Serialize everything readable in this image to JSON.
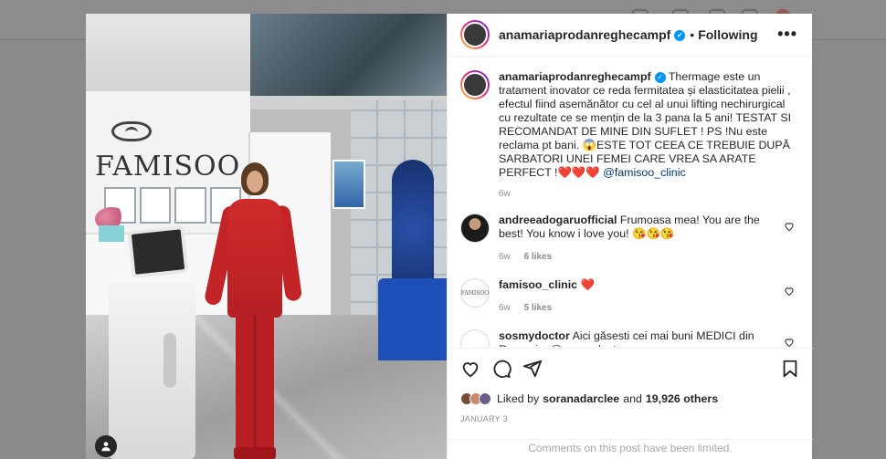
{
  "post": {
    "username": "anamariaprodanreghecampf",
    "follow_status": "Following",
    "more_label": "•••",
    "caption": {
      "username": "anamariaprodanreghecampf",
      "text": "Thermage este un tratament inovator ce reda fermitatea și elasticitatea pielii , efectul fiind asemănător cu cel al unui lifting nechirurgical cu rezultate ce se mențin de la 3 pana la 5 ani! TESTAT SI RECOMANDAT DE MINE DIN SUFLET ! PS !Nu este reclama pt bani. 😱ESTE TOT CEEA CE TREBUIE DUPĂ SARBATORI UNEI FEMEI CARE VREA SA ARATE PERFECT !",
      "hearts": "❤️❤️❤️",
      "mention": "@famisoo_clinic",
      "age": "6w"
    },
    "comments": [
      {
        "username": "andreeadogaruofficial",
        "text": "Frumoasa mea! You are the best! You know i love you! 😘😘😘",
        "age": "6w",
        "likes": "6 likes"
      },
      {
        "username": "famisoo_clinic",
        "text": "❤️",
        "age": "6w",
        "likes": "5 likes"
      },
      {
        "username": "sosmydoctor",
        "text": "Aici găsesti cei mai buni MEDICI din Romania: @sosmydoctor",
        "age": "",
        "likes": ""
      }
    ],
    "liked_by": {
      "prefix": "Liked by",
      "user": "soranadarclee",
      "and": "and",
      "others": "19,926 others"
    },
    "date": "JANUARY 3",
    "comments_limited": "Comments on this post have been limited."
  },
  "photo": {
    "brand_text": "FAMISOO",
    "brand_text_2": "SOO"
  },
  "icons": {
    "verified": "✓",
    "avatar_small_famisoo": "FAMISOO"
  },
  "colors": {
    "accent": "#0095f6",
    "heart": "#ed4956",
    "jacket": "#c22427",
    "sofa": "#1e4fb8"
  }
}
